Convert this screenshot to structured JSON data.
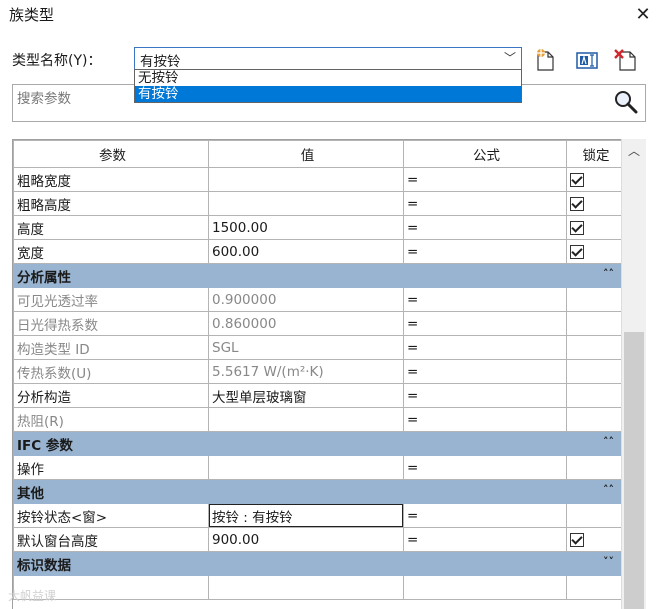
{
  "window": {
    "title": "族类型",
    "close_glyph": "✕"
  },
  "type_selector": {
    "label": "类型名称(Y)：",
    "selected": "有按铃",
    "options": [
      "无按铃",
      "有按铃"
    ]
  },
  "toolbar": {
    "icons": [
      "new-type-icon",
      "rename-type-icon",
      "delete-type-icon"
    ]
  },
  "search": {
    "placeholder": "搜索参数"
  },
  "grid": {
    "headers": {
      "param": "参数",
      "value": "值",
      "formula": "公式",
      "lock": "锁定"
    },
    "rows": [
      {
        "param": "粗略宽度",
        "value": "",
        "formula": "=",
        "locked": true
      },
      {
        "param": "粗略高度",
        "value": "",
        "formula": "=",
        "locked": true
      },
      {
        "param": "高度",
        "value": "1500.00",
        "formula": "=",
        "locked": true
      },
      {
        "param": "宽度",
        "value": "600.00",
        "formula": "=",
        "locked": true
      }
    ],
    "groups": {
      "analysis": {
        "title": "分析属性",
        "chevron": "˄˄"
      },
      "ifc": {
        "title": "IFC 参数",
        "chevron": "˄˄"
      },
      "other": {
        "title": "其他",
        "chevron": "˄˄"
      },
      "id": {
        "title": "标识数据",
        "chevron": "˅˅"
      }
    },
    "analysis_rows": [
      {
        "param": "可见光透过率",
        "value": "0.900000",
        "formula": "="
      },
      {
        "param": "日光得热系数",
        "value": "0.860000",
        "formula": "="
      },
      {
        "param": "构造类型 ID",
        "value": "SGL",
        "formula": "="
      },
      {
        "param": "传热系数(U)",
        "value": "5.5617 W/(m²·K)",
        "formula": "="
      },
      {
        "param": "分析构造",
        "value": "大型单层玻璃窗",
        "formula": "="
      },
      {
        "param": "热阻(R)",
        "value": "",
        "formula": "="
      }
    ],
    "ifc_rows": [
      {
        "param": "操作",
        "value": "",
        "formula": "="
      }
    ],
    "other_rows": [
      {
        "param": "按铃状态<窗>",
        "value": "按铃 : 有按铃",
        "formula": "="
      },
      {
        "param": "默认窗台高度",
        "value": "900.00",
        "formula": "=",
        "locked": true
      }
    ]
  },
  "watermark": "大帆益课"
}
